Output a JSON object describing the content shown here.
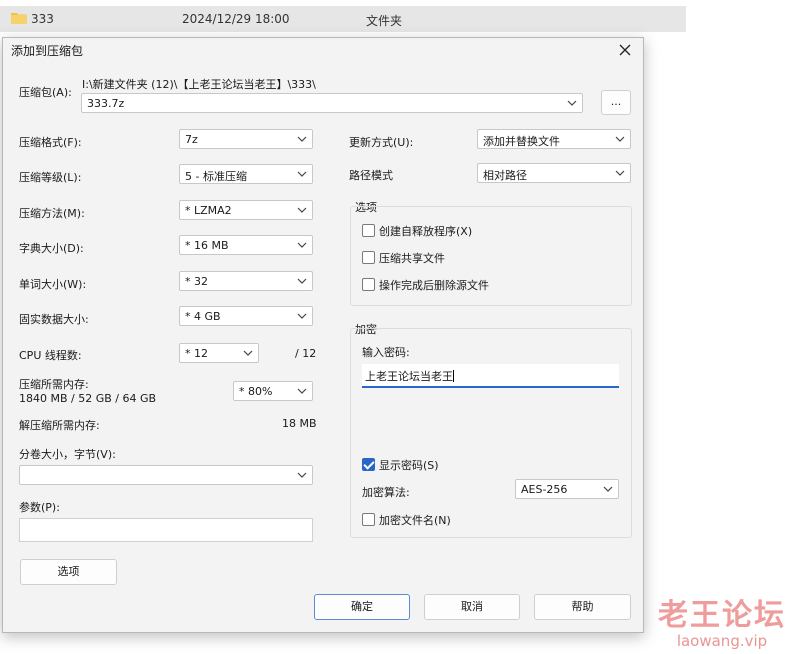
{
  "explorer_row": {
    "name": "333",
    "date": "2024/12/29 18:00",
    "type": "文件夹"
  },
  "dialog": {
    "title": "添加到压缩包"
  },
  "archive": {
    "label": "压缩包(A):",
    "path": "I:\\新建文件夹 (12)\\【上老王论坛当老王】\\333\\",
    "name": "333.7z",
    "browse_label": "..."
  },
  "left": {
    "format_label": "压缩格式(F):",
    "format_value": "7z",
    "level_label": "压缩等级(L):",
    "level_value": "5 - 标准压缩",
    "method_label": "压缩方法(M):",
    "method_value": "*  LZMA2",
    "dict_label": "字典大小(D):",
    "dict_value": "*  16 MB",
    "word_label": "单词大小(W):",
    "word_value": "*  32",
    "solid_label": "固实数据大小:",
    "solid_value": "*  4 GB",
    "threads_label": "CPU 线程数:",
    "threads_value": "*  12",
    "threads_total": "/ 12",
    "mem_label": "压缩所需内存:",
    "mem_detail": "1840 MB / 52 GB / 64 GB",
    "mem_value": "*  80%",
    "decomp_label": "解压缩所需内存:",
    "decomp_value": "18 MB",
    "volume_label": "分卷大小，字节(V):",
    "volume_value": "",
    "params_label": "参数(P):",
    "params_value": "",
    "options_button": "选项"
  },
  "right": {
    "update_label": "更新方式(U):",
    "update_value": "添加并替换文件",
    "pathmode_label": "路径模式",
    "pathmode_value": "相对路径",
    "options_group": "选项",
    "opt_sfx": "创建自释放程序(X)",
    "opt_shared": "压缩共享文件",
    "opt_delete": "操作完成后删除源文件",
    "encrypt_group": "加密",
    "password_label": "输入密码:",
    "password_value": "上老王论坛当老王",
    "show_password": "显示密码(S)",
    "method_label": "加密算法:",
    "method_value": "AES-256",
    "encrypt_names": "加密文件名(N)"
  },
  "footer": {
    "ok": "确定",
    "cancel": "取消",
    "help": "帮助"
  },
  "watermark": {
    "line1": "老王论坛",
    "line2": "laowang.vip"
  },
  "checkbox_states": {
    "opt_sfx": false,
    "opt_shared": false,
    "opt_delete": false,
    "show_password": true,
    "encrypt_names": false
  }
}
